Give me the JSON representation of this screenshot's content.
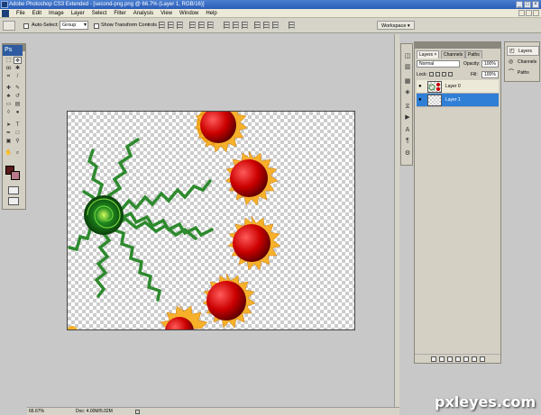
{
  "title_bar": {
    "title": "Adobe Photoshop CS3 Extended - [second-png.png @ 66.7% (Layer 1, RGB/16)]"
  },
  "menu": [
    "File",
    "Edit",
    "Image",
    "Layer",
    "Select",
    "Filter",
    "Analysis",
    "View",
    "Window",
    "Help"
  ],
  "options_bar": {
    "auto_select_label": "Auto-Select:",
    "auto_select_value": "Group",
    "show_transform_label": "Show Transform Controls",
    "workspace_label": "Workspace ▾"
  },
  "toolbox": {
    "logo": "Ps"
  },
  "status_bar": {
    "zoom": "66.67%",
    "doc_info": "Doc: 4.00M/5.02M"
  },
  "layers_panel": {
    "tabs": [
      "Layers ×",
      "Channels",
      "Paths"
    ],
    "blend_mode": "Normal",
    "opacity_label": "Opacity:",
    "opacity_value": "100%",
    "lock_label": "Lock:",
    "fill_label": "Fill:",
    "fill_value": "100%",
    "layers": [
      {
        "name": "Layer 0",
        "selected": false
      },
      {
        "name": "Layer 1",
        "selected": true
      }
    ]
  },
  "dock": {
    "items": [
      "Layers",
      "Channels",
      "Paths"
    ]
  },
  "watermark": "pxleyes.com",
  "colors": {
    "foreground": "#5a1a1a",
    "background": "#b87a8a",
    "selection": "#2f7fd6"
  }
}
